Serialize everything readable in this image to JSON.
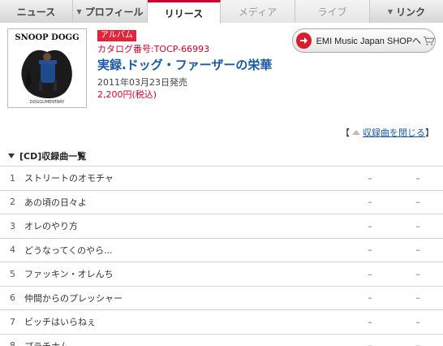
{
  "nav": {
    "tabs": [
      {
        "label": "ニュース",
        "state": "normal",
        "dropdown": false
      },
      {
        "label": "プロフィール",
        "state": "normal",
        "dropdown": true
      },
      {
        "label": "リリース",
        "state": "active",
        "dropdown": false
      },
      {
        "label": "メディア",
        "state": "disabled",
        "dropdown": false
      },
      {
        "label": "ライブ",
        "state": "disabled",
        "dropdown": false
      },
      {
        "label": "リンク",
        "state": "normal",
        "dropdown": true
      }
    ]
  },
  "product": {
    "cover_brand_text": "SNOOP DOGG",
    "cover_sub_text": "DOGGUMENTARY",
    "type_badge": "アルバム",
    "catalog": "カタログ番号:TOCP-66993",
    "title": "実録.ドッグ・ファーザーの栄華",
    "release_date": "2011年03月23日発売",
    "price": "2,200円(税込)"
  },
  "shop_button": {
    "label": "EMI Music Japan SHOPへ"
  },
  "close_link": {
    "bracket_open": "【",
    "label": "収録曲を閉じる",
    "bracket_close": "】"
  },
  "section": {
    "title": "[CD]収録曲一覧"
  },
  "tracks": [
    {
      "no": "1",
      "name": "ストリートのオモチャ",
      "c1": "–",
      "c2": "–"
    },
    {
      "no": "2",
      "name": "あの頃の日々よ",
      "c1": "–",
      "c2": "–"
    },
    {
      "no": "3",
      "name": "オレのやり方",
      "c1": "–",
      "c2": "–"
    },
    {
      "no": "4",
      "name": "どうなってくのやら...",
      "c1": "–",
      "c2": "–"
    },
    {
      "no": "5",
      "name": "ファッキン・オレんち",
      "c1": "–",
      "c2": "–"
    },
    {
      "no": "6",
      "name": "仲間からのプレッシャー",
      "c1": "–",
      "c2": "–"
    },
    {
      "no": "7",
      "name": "ビッチはいらねぇ",
      "c1": "–",
      "c2": "–"
    },
    {
      "no": "8",
      "name": "プラチナム",
      "c1": "–",
      "c2": "–"
    }
  ],
  "colors": {
    "accent_red": "#d3002d",
    "link_blue": "#1a5aa5"
  }
}
